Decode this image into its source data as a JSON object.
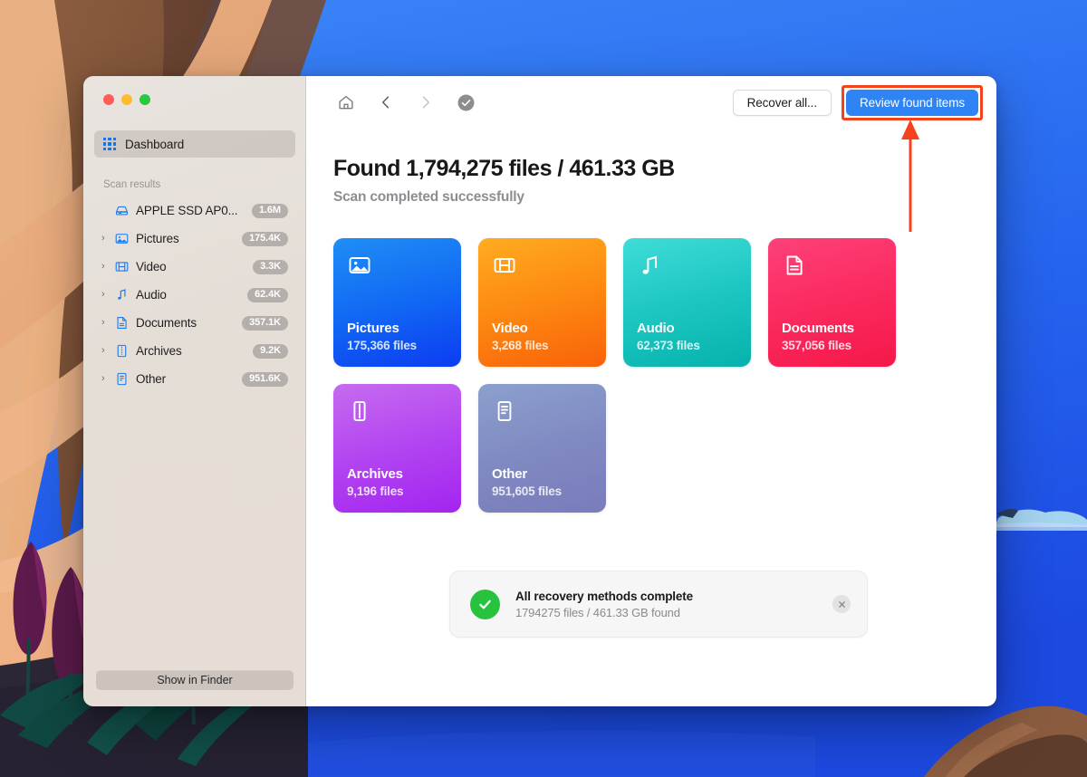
{
  "window": {
    "traffic_lights": [
      "close",
      "minimize",
      "zoom"
    ]
  },
  "sidebar": {
    "dashboard": {
      "label": "Dashboard",
      "icon": "grid-icon"
    },
    "section_title": "Scan results",
    "items": [
      {
        "label": "APPLE SSD AP0...",
        "badge": "1.6M",
        "icon": "disk-icon",
        "expandable": false
      },
      {
        "label": "Pictures",
        "badge": "175.4K",
        "icon": "picture-icon",
        "expandable": true
      },
      {
        "label": "Video",
        "badge": "3.3K",
        "icon": "film-icon",
        "expandable": true
      },
      {
        "label": "Audio",
        "badge": "62.4K",
        "icon": "note-icon",
        "expandable": true
      },
      {
        "label": "Documents",
        "badge": "357.1K",
        "icon": "document-icon",
        "expandable": true
      },
      {
        "label": "Archives",
        "badge": "9.2K",
        "icon": "archive-icon",
        "expandable": true
      },
      {
        "label": "Other",
        "badge": "951.6K",
        "icon": "other-icon",
        "expandable": true
      }
    ],
    "show_in_finder": "Show in Finder"
  },
  "toolbar": {
    "home_icon": "home-icon",
    "back_icon": "chevron-left-icon",
    "forward_icon": "chevron-right-icon",
    "status_icon": "check-circle-icon",
    "recover_all": "Recover all...",
    "review_found_items": "Review found items"
  },
  "main": {
    "headline": "Found 1,794,275 files / 461.33 GB",
    "subhead": "Scan completed successfully",
    "cards": [
      {
        "title": "Pictures",
        "count": "175,366 files",
        "icon": "picture-icon",
        "c1": "#1f8ef5",
        "c2": "#0f3ff2"
      },
      {
        "title": "Video",
        "count": "3,268 files",
        "icon": "film-icon",
        "c1": "#ffa91e",
        "c2": "#fa6a0c"
      },
      {
        "title": "Audio",
        "count": "62,373 files",
        "icon": "note-icon",
        "c1": "#3ad6d6",
        "c2": "#06b5ad"
      },
      {
        "title": "Documents",
        "count": "357,056 files",
        "icon": "document-icon",
        "c1": "#fb3a75",
        "c2": "#f6204f"
      },
      {
        "title": "Archives",
        "count": "9,196 files",
        "icon": "archive-icon",
        "c1": "#c164ef",
        "c2": "#a32af0"
      },
      {
        "title": "Other",
        "count": "951,605 files",
        "icon": "other-icon",
        "c1": "#8496c7",
        "c2": "#7a7fbb"
      }
    ]
  },
  "notification": {
    "title": "All recovery methods complete",
    "subtitle": "1794275 files / 461.33 GB found",
    "check_icon": "check-icon",
    "close_icon": "close-icon",
    "accent": "#28c33e"
  },
  "annotation": {
    "highlight_color": "#f4431c",
    "target": "review_found_items"
  }
}
